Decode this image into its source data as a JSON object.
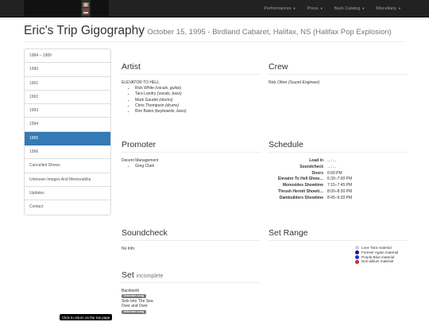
{
  "navbar": {
    "menu": [
      {
        "label": "Performances"
      },
      {
        "label": "Press"
      },
      {
        "label": "Back Catalog"
      },
      {
        "label": "Miscellany"
      }
    ]
  },
  "header": {
    "title": "Eric's Trip Gigography",
    "subtitle": "October 15, 1995 - Birdland Cabaret, Halifax, NS (Halifax Pop Explosion)"
  },
  "sidebar": {
    "items": [
      {
        "label": "1984 – 1989",
        "active": false
      },
      {
        "label": "1990",
        "active": false
      },
      {
        "label": "1991",
        "active": false
      },
      {
        "label": "1992",
        "active": false
      },
      {
        "label": "1993",
        "active": false
      },
      {
        "label": "1994",
        "active": false
      },
      {
        "label": "1995",
        "active": true
      },
      {
        "label": "1996",
        "active": false
      },
      {
        "label": "Cancelled Shows",
        "active": false
      },
      {
        "label": "Unknown Images And Memorabilia",
        "active": false
      },
      {
        "label": "Updates",
        "active": false
      },
      {
        "label": "Contact",
        "active": false
      }
    ]
  },
  "artist": {
    "heading": "Artist",
    "band": "ELEVATOR TO HELL",
    "members": [
      {
        "name": "Rick White",
        "role": "(vocals, guitar)"
      },
      {
        "name": "Tara Landry",
        "role": "(vocals, bass)"
      },
      {
        "name": "Mark Gaudet",
        "role": "(drums)"
      },
      {
        "name": "Chris Thompson",
        "role": "(drums)"
      },
      {
        "name": "Ron Bates",
        "role": "(keyboards, bass)"
      }
    ]
  },
  "crew": {
    "heading": "Crew",
    "name": "Nick Other",
    "role": "(Sound Engineer)"
  },
  "promoter": {
    "heading": "Promoter",
    "company": "Decent Management",
    "people": [
      "Greg Clark"
    ]
  },
  "schedule": {
    "heading": "Schedule",
    "rows": [
      {
        "label": "Load In",
        "value": "…:…"
      },
      {
        "label": "Soundcheck",
        "value": "…:…"
      },
      {
        "label": "Doors",
        "value": "6:00 PM"
      },
      {
        "label": "Elevator To Hell Show…",
        "value": "6:30–7:00 PM"
      },
      {
        "label": "Monoxides Showtime",
        "value": "7:15–7:45 PM"
      },
      {
        "label": "Thrush Hermit Showti…",
        "value": "8:00–8:30 PM"
      },
      {
        "label": "Dambuilders Showtime",
        "value": "8:45–9:30 PM"
      }
    ]
  },
  "soundcheck": {
    "heading": "Soundcheck",
    "info": "No Info"
  },
  "setrange": {
    "heading": "Set Range",
    "legend": [
      {
        "label": "Love Tara material",
        "color": "#cfcfcf"
      },
      {
        "label": "Forever Again material",
        "color": "#1a1a8c"
      },
      {
        "label": "Purple Blue material",
        "color": "#2233cc"
      },
      {
        "label": "Non-album material",
        "color": "#d9263c"
      }
    ]
  },
  "set": {
    "heading": "Set",
    "status": "incomplete",
    "songs": [
      {
        "title": "Backteeth",
        "badge": "Unknown song"
      },
      {
        "title": "Sink Into The Sea",
        "badge": ""
      },
      {
        "title": "Over and Over",
        "badge": "Unknown song"
      }
    ]
  },
  "tooltip": {
    "text": "Click to return on the top page"
  }
}
